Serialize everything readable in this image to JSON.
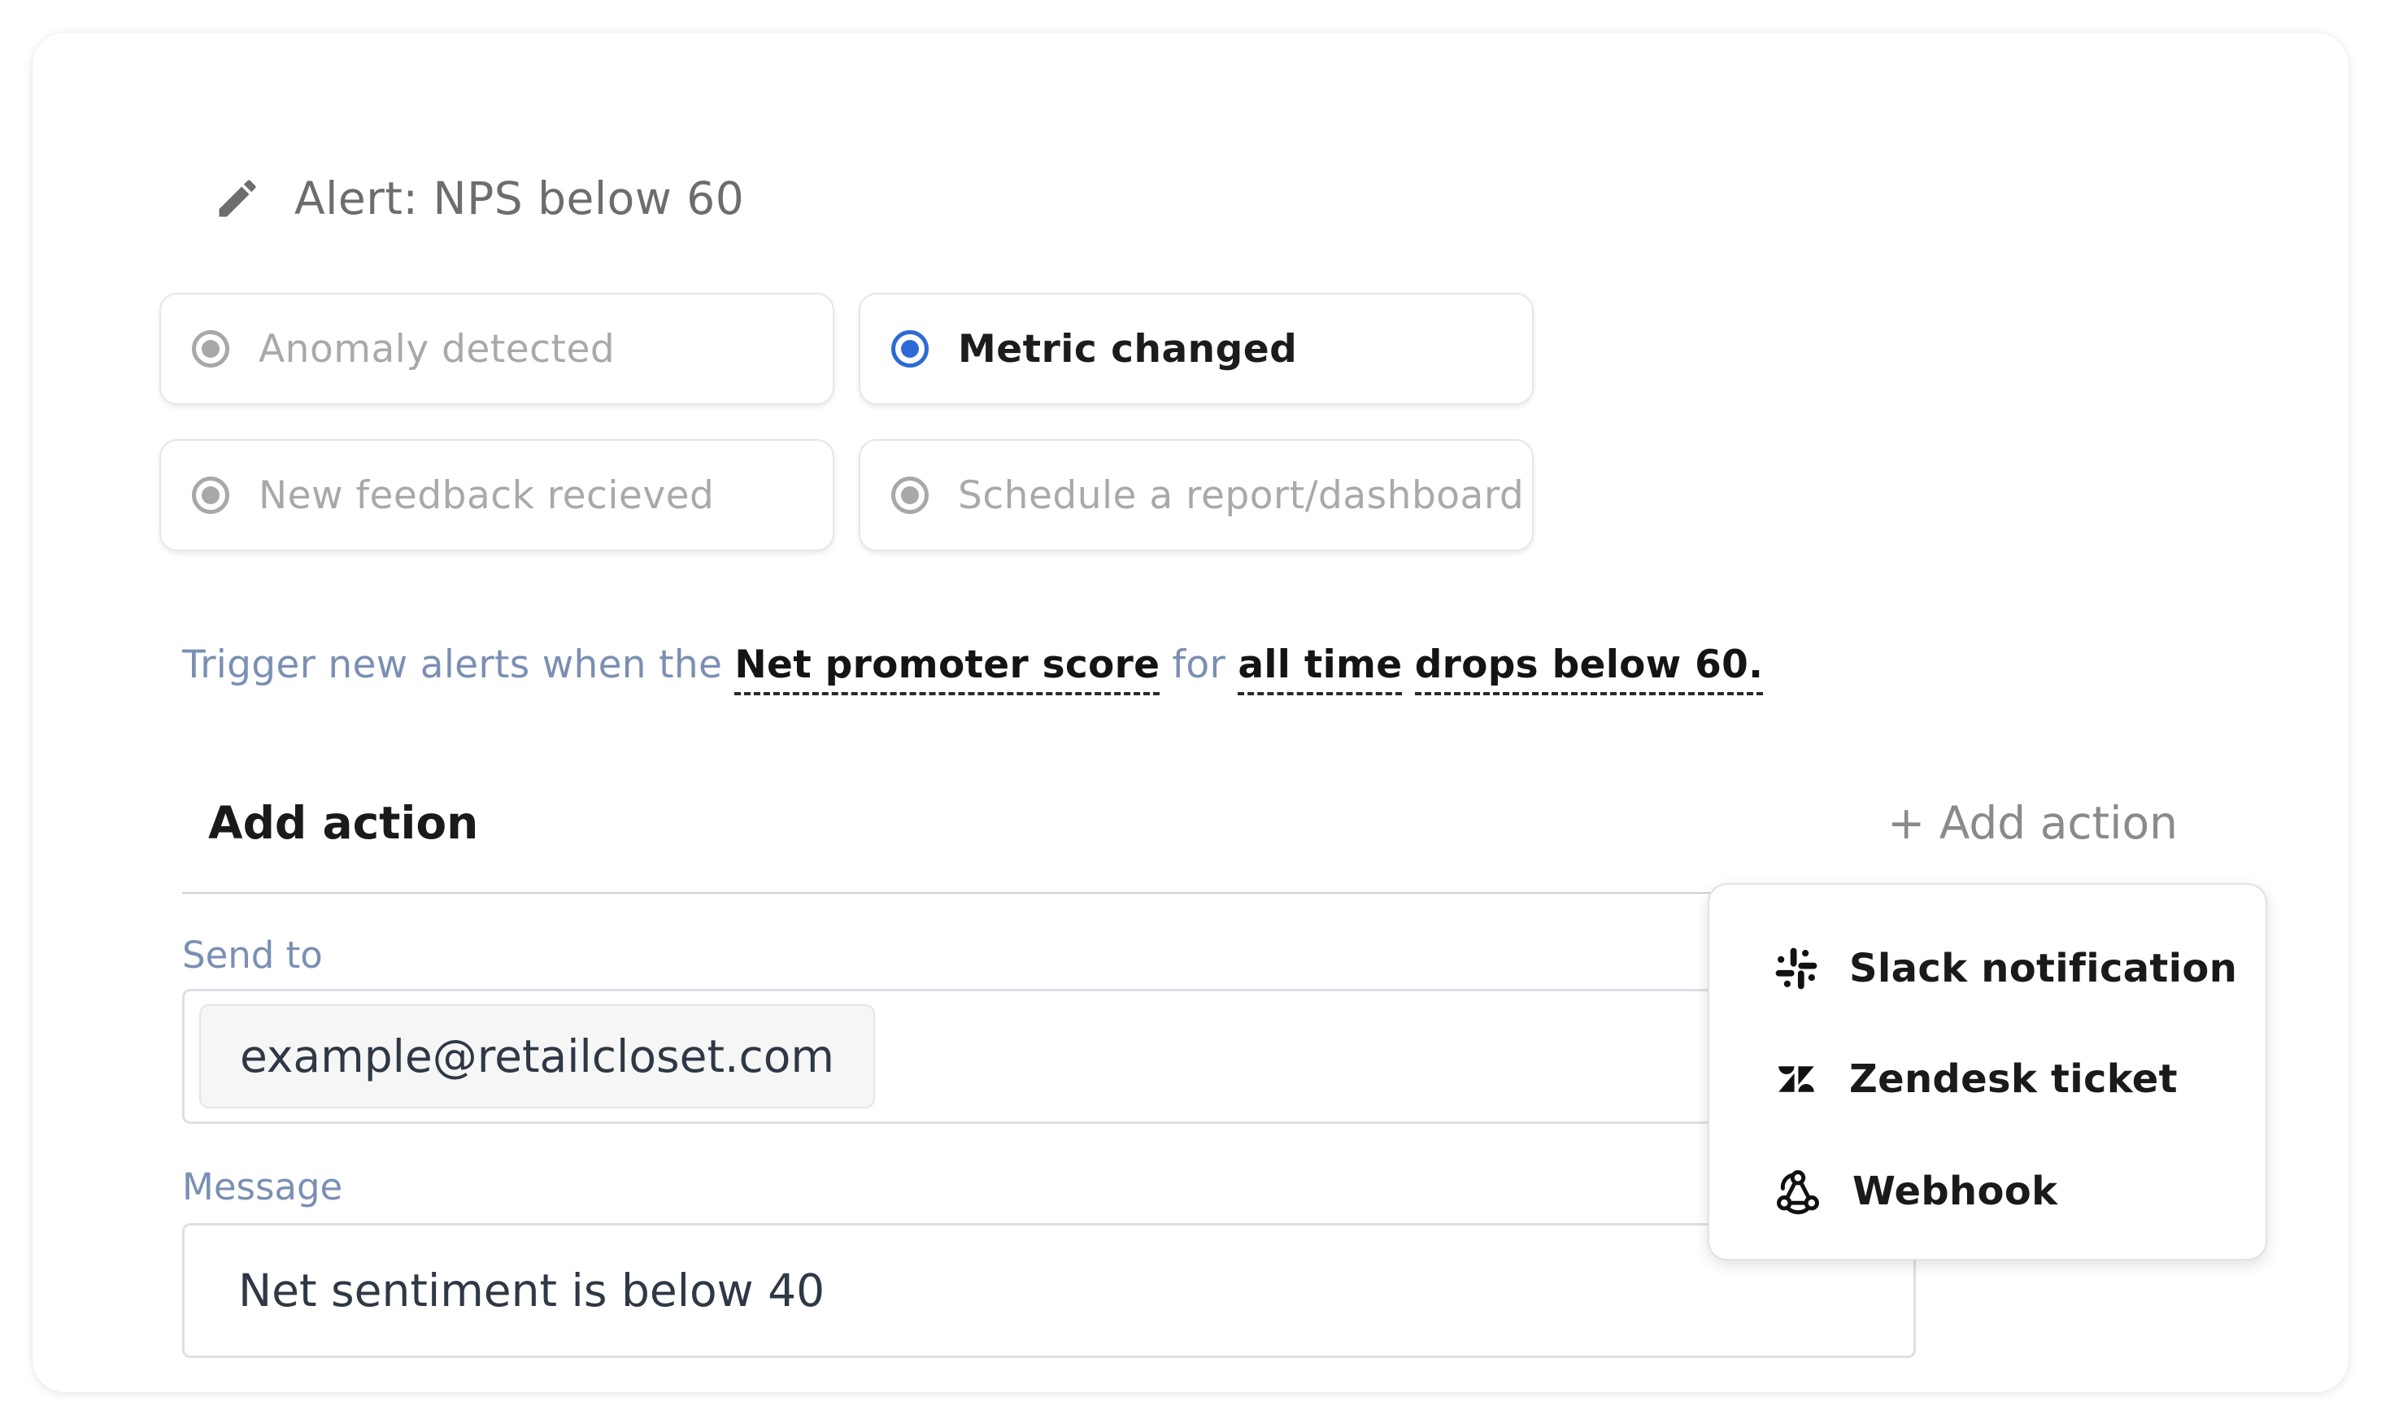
{
  "alert": {
    "title": "Alert: NPS below 60"
  },
  "triggers": {
    "options": [
      {
        "label": "Anomaly detected",
        "selected": false
      },
      {
        "label": "Metric changed",
        "selected": true
      },
      {
        "label": "New feedback recieved",
        "selected": false
      },
      {
        "label": "Schedule a report/dashboard",
        "selected": false
      }
    ]
  },
  "condition": {
    "prefix": "Trigger new alerts when the ",
    "metric": "Net promoter score",
    "connector": " for ",
    "period": "all time",
    "space": " ",
    "rule": "drops below 60."
  },
  "actions": {
    "section_title": "Add action",
    "add_button_label": "+ Add action"
  },
  "form": {
    "send_to_label": "Send to",
    "recipient": "example@retailcloset.com",
    "message_label": "Message",
    "message_value": "Net sentiment is below 40"
  },
  "action_menu": {
    "items": [
      {
        "label": "Slack notification",
        "icon": "slack-icon"
      },
      {
        "label": "Zendesk ticket",
        "icon": "zendesk-icon"
      },
      {
        "label": "Webhook",
        "icon": "webhook-icon"
      }
    ]
  },
  "colors": {
    "accent": "#2d6ad6",
    "muted_text": "#a9a9a9",
    "label_blue_gray": "#7a8fb3"
  }
}
